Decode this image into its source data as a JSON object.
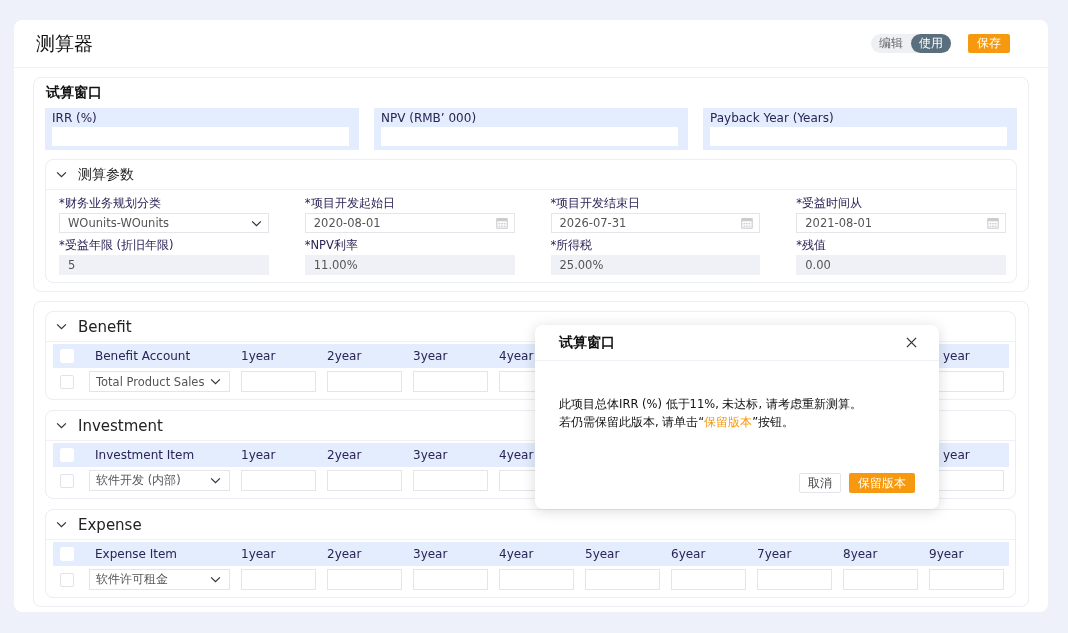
{
  "header": {
    "title": "测算器",
    "mode_toggle": [
      {
        "label": "编辑",
        "selected": false
      },
      {
        "label": "使用",
        "selected": true
      }
    ],
    "save_button": "保存"
  },
  "trial_window": {
    "title": "试算窗口",
    "metrics": [
      {
        "label": "IRR (%)"
      },
      {
        "label": "NPV (RMB’ 000)"
      },
      {
        "label": "Payback Year (Years)"
      }
    ]
  },
  "parameters": {
    "title": "测算参数",
    "expanded": true,
    "fields": [
      {
        "label": "*财务业务规划分类",
        "value": "WOunits-WOunits",
        "kind": "select"
      },
      {
        "label": "*项目开发起始日",
        "value": "2020-08-01",
        "kind": "date"
      },
      {
        "label": "*项目开发结束日",
        "value": "2026-07-31",
        "kind": "date"
      },
      {
        "label": "*受益时间从",
        "value": "2021-08-01",
        "kind": "date"
      },
      {
        "label": "*受益年限 (折旧年限)",
        "value": "5",
        "kind": "readonly"
      },
      {
        "label": "*NPV利率",
        "value": "11.00%",
        "kind": "readonly"
      },
      {
        "label": "*所得税",
        "value": "25.00%",
        "kind": "readonly"
      },
      {
        "label": "*残值",
        "value": "0.00",
        "kind": "readonly"
      }
    ]
  },
  "sections": [
    {
      "title": "Benefit",
      "expanded": true,
      "all_checked": false,
      "item_header": "Benefit Account",
      "columns": [
        "1year",
        "2year",
        "3year",
        "4year",
        "year"
      ],
      "rows": [
        {
          "item": "Total Product Sales",
          "checked": false
        }
      ]
    },
    {
      "title": "Investment",
      "expanded": true,
      "all_checked": false,
      "item_header": "Investment Item",
      "columns": [
        "1year",
        "2year",
        "3year",
        "4year",
        "year"
      ],
      "rows": [
        {
          "item": "软件开发 (内部)",
          "checked": false
        }
      ]
    },
    {
      "title": "Expense",
      "expanded": true,
      "all_checked": false,
      "item_header": "Expense Item",
      "columns": [
        "1year",
        "2year",
        "3year",
        "4year",
        "5year",
        "6year",
        "7year",
        "8year",
        "9year"
      ],
      "rows": [
        {
          "item": "软件许可租金",
          "checked": false
        }
      ]
    }
  ],
  "dialog": {
    "title": "试算窗口",
    "message": [
      "此项目总体IRR (%) 低于11%, 未达标, 请考虑重新测算。",
      "若仍需保留此版本, 请单击“**保留版本**”按钮。"
    ],
    "cancel_button": "取消",
    "confirm_button": "保留版本"
  }
}
